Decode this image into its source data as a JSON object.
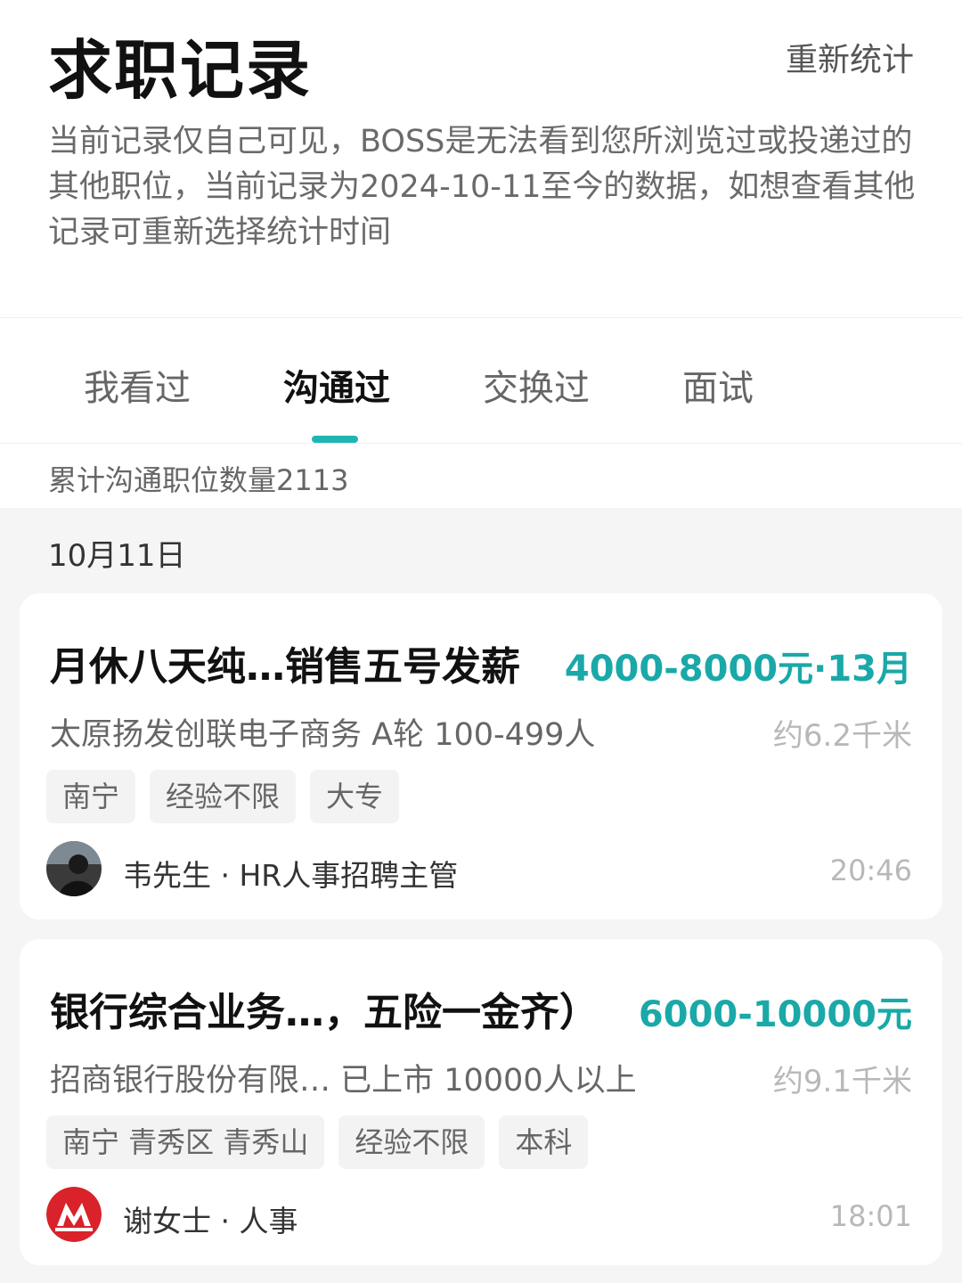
{
  "header": {
    "title": "求职记录",
    "restat_label": "重新统计",
    "description": "当前记录仅自己可见，BOSS是无法看到您所浏览过或投递过的其他职位，当前记录为2024-10-11至今的数据，如想查看其他记录可重新选择统计时间"
  },
  "tabs": [
    {
      "label": "我看过",
      "active": false
    },
    {
      "label": "沟通过",
      "active": true
    },
    {
      "label": "交换过",
      "active": false
    },
    {
      "label": "面试",
      "active": false
    }
  ],
  "summary": {
    "count_text": "累计沟通职位数量2113"
  },
  "date_group": "10月11日",
  "jobs": [
    {
      "title": "月休八天纯…销售五号发薪",
      "salary": "4000-8000元·13月",
      "company": "太原扬发创联电子商务 A轮 100-499人",
      "distance": "约6.2千米",
      "tags": [
        "南宁",
        "经验不限",
        "大专"
      ],
      "recruiter": "韦先生 · HR人事招聘主管",
      "time": "20:46",
      "avatar_icon": "person-photo-icon"
    },
    {
      "title": "银行综合业务…，五险一金齐）",
      "salary": "6000-10000元",
      "company": "招商银行股份有限… 已上市 10000人以上",
      "distance": "约9.1千米",
      "tags": [
        "南宁 青秀区 青秀山",
        "经验不限",
        "本科"
      ],
      "recruiter": "谢女士 · 人事",
      "time": "18:01",
      "avatar_icon": "cmb-logo-icon"
    }
  ],
  "colors": {
    "accent": "#1aa8a8",
    "tab_indicator": "#1fb5b3",
    "logo_red": "#d9222a",
    "background": "#f5f5f5"
  }
}
